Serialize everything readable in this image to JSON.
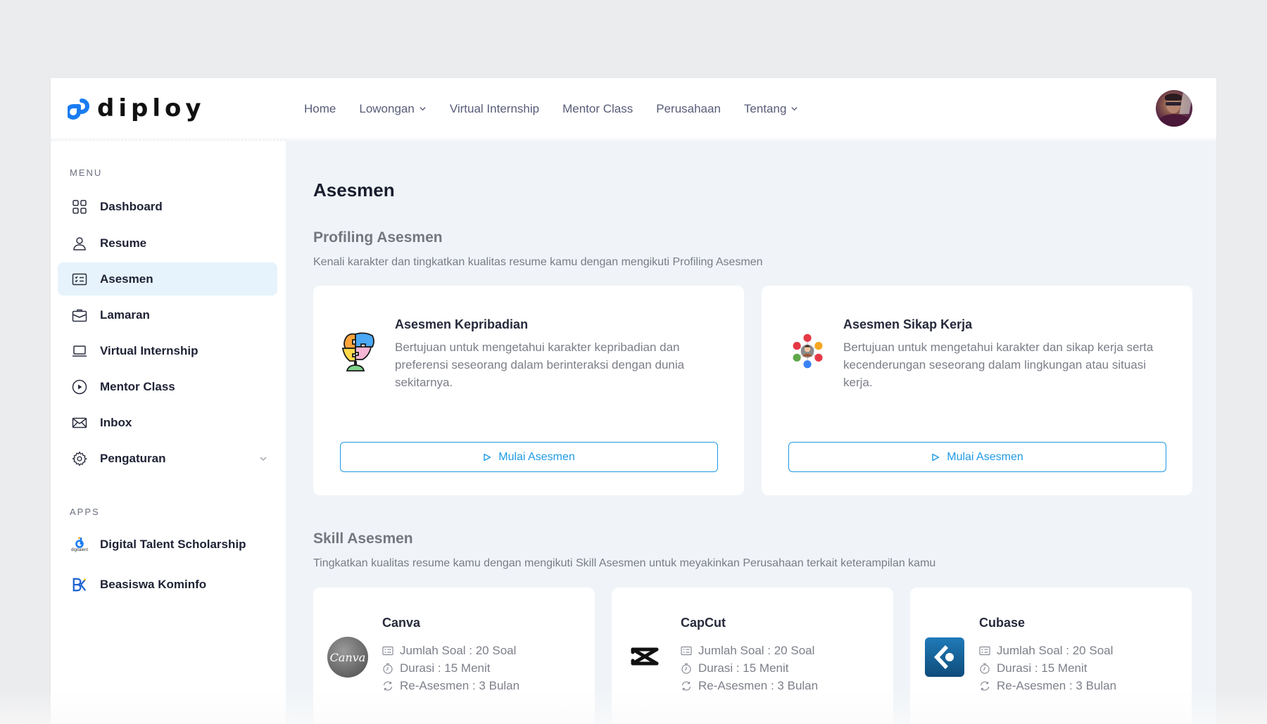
{
  "app": {
    "brand": "diploy"
  },
  "nav": {
    "items": [
      {
        "label": "Home",
        "has_dropdown": false
      },
      {
        "label": "Lowongan",
        "has_dropdown": true
      },
      {
        "label": "Virtual Internship",
        "has_dropdown": false
      },
      {
        "label": "Mentor Class",
        "has_dropdown": false
      },
      {
        "label": "Perusahaan",
        "has_dropdown": false
      },
      {
        "label": "Tentang",
        "has_dropdown": true
      }
    ]
  },
  "sidebar": {
    "menu_heading": "MENU",
    "items": [
      {
        "label": "Dashboard",
        "icon": "grid-icon",
        "active": false
      },
      {
        "label": "Resume",
        "icon": "user-icon",
        "active": false
      },
      {
        "label": "Asesmen",
        "icon": "checklist-icon",
        "active": true
      },
      {
        "label": "Lamaran",
        "icon": "briefcase-icon",
        "active": false
      },
      {
        "label": "Virtual Internship",
        "icon": "laptop-icon",
        "active": false
      },
      {
        "label": "Mentor Class",
        "icon": "play-circle-icon",
        "active": false
      },
      {
        "label": "Inbox",
        "icon": "mail-icon",
        "active": false
      },
      {
        "label": "Pengaturan",
        "icon": "gear-icon",
        "active": false,
        "expandable": true
      }
    ],
    "apps_heading": "APPS",
    "apps": [
      {
        "label": "Digital Talent Scholarship",
        "icon": "digitalent-logo-icon",
        "logo_caption": "digitalent"
      },
      {
        "label": "Beasiswa Kominfo",
        "icon": "bk-logo-icon"
      }
    ]
  },
  "main": {
    "page_title": "Asesmen",
    "profiling": {
      "title": "Profiling Asesmen",
      "description": "Kenali karakter dan tingkatkan kualitas resume kamu dengan mengikuti Profiling Asesmen",
      "cards": [
        {
          "title": "Asesmen Kepribadian",
          "description": "Bertujuan untuk mengetahui karakter kepribadian dan preferensi seseorang dalam berinteraksi dengan dunia sekitarnya.",
          "icon": "puzzle-head-icon",
          "button_label": "Mulai Asesmen"
        },
        {
          "title": "Asesmen Sikap Kerja",
          "description": "Bertujuan untuk mengetahui karakter dan sikap kerja serta kecenderungan seseorang dalam lingkungan atau situasi kerja.",
          "icon": "person-network-icon",
          "button_label": "Mulai Asesmen"
        }
      ]
    },
    "skill": {
      "title": "Skill Asesmen",
      "description": "Tingkatkan kualitas resume kamu dengan mengikuti Skill Asesmen untuk meyakinkan Perusahaan terkait keterampilan kamu",
      "cards": [
        {
          "title": "Canva",
          "logo": "canva-logo",
          "logo_text": "Canva",
          "jumlah_soal": "Jumlah Soal : 20 Soal",
          "durasi": "Durasi : 15 Menit",
          "re_asesmen": "Re-Asesmen : 3 Bulan"
        },
        {
          "title": "CapCut",
          "logo": "capcut-logo",
          "jumlah_soal": "Jumlah Soal : 20 Soal",
          "durasi": "Durasi : 15 Menit",
          "re_asesmen": "Re-Asesmen : 3 Bulan"
        },
        {
          "title": "Cubase",
          "logo": "cubase-logo",
          "jumlah_soal": "Jumlah Soal : 20 Soal",
          "durasi": "Durasi : 15 Menit",
          "re_asesmen": "Re-Asesmen : 3 Bulan"
        }
      ]
    }
  },
  "colors": {
    "accent": "#1e9ae6",
    "brand_blue": "#1a7cf2",
    "active_bg": "#e6f3fc",
    "main_bg": "#f0f4f8",
    "page_bg": "#ebecee"
  }
}
